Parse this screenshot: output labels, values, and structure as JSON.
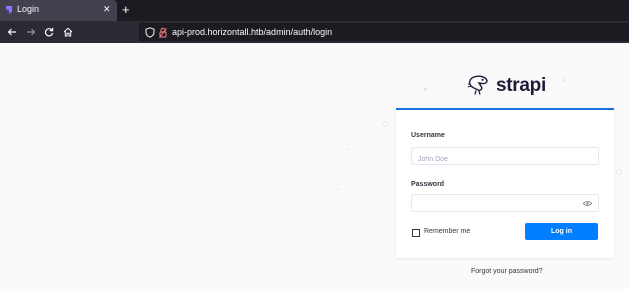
{
  "browser": {
    "tab_title": "Login",
    "tab_close": "✕",
    "new_tab": "+",
    "url": "api-prod.horizontall.htb/admin/auth/login"
  },
  "page": {
    "logo_text": "strapi",
    "username_label": "Username",
    "username_placeholder": "John Doe",
    "password_label": "Password",
    "remember_label": "Remember me",
    "login_label": "Log in",
    "forgot_label": "Forgot your password?"
  },
  "icons": {
    "favicon": "strapi-logo-icon",
    "back": "arrow-left-icon",
    "forward": "arrow-right-icon",
    "reload": "reload-icon",
    "home": "home-icon",
    "tracking": "shield-icon",
    "permissions": "lock-icon",
    "show_password": "eye-icon"
  },
  "colors": {
    "accent": "#007eff",
    "card_top_border": "#1c6fe0",
    "text": "#333740",
    "tab_active": "#42414d",
    "chrome_dark": "#1c1b22",
    "toolbar": "#2b2a33"
  }
}
